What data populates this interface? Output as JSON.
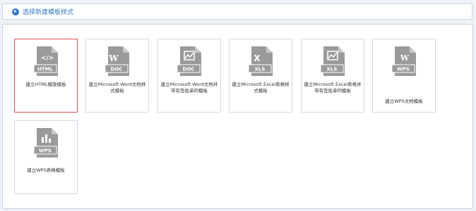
{
  "header": {
    "title": "选择新建模板样式"
  },
  "templates": [
    {
      "name": "tpl-html",
      "badge": "HTML",
      "glyph": "</>",
      "label": "建立HTML模版模板",
      "selected": true
    },
    {
      "name": "tpl-word",
      "badge": "DOC",
      "glyph": "W",
      "label": "建立Microsoft Word文档样式模板",
      "selected": false
    },
    {
      "name": "tpl-word-approval",
      "badge": "DOC",
      "glyph": "~",
      "label": "建立Microsoft Word文档并带有签批单的模板",
      "selected": false
    },
    {
      "name": "tpl-excel",
      "badge": "XLS",
      "glyph": "X",
      "label": "建立Microsoft Excel表格样式模板",
      "selected": false
    },
    {
      "name": "tpl-excel-approval",
      "badge": "XLS",
      "glyph": "~",
      "label": "建立Microsoft Excel表格并带有签批单的模板",
      "selected": false
    },
    {
      "name": "tpl-wps-doc",
      "badge": "WPS",
      "glyph": "W",
      "label": "建立WPS文档模板",
      "selected": false
    },
    {
      "name": "tpl-wps-sheet",
      "badge": "WPS",
      "glyph": "bars",
      "label": "建立WPS表格模板",
      "selected": false
    }
  ],
  "colors": {
    "accent": "#2f79c6",
    "icon_gray": "#9a9a9a",
    "selected_border": "#d65050",
    "card_border": "#cfd9e6"
  }
}
